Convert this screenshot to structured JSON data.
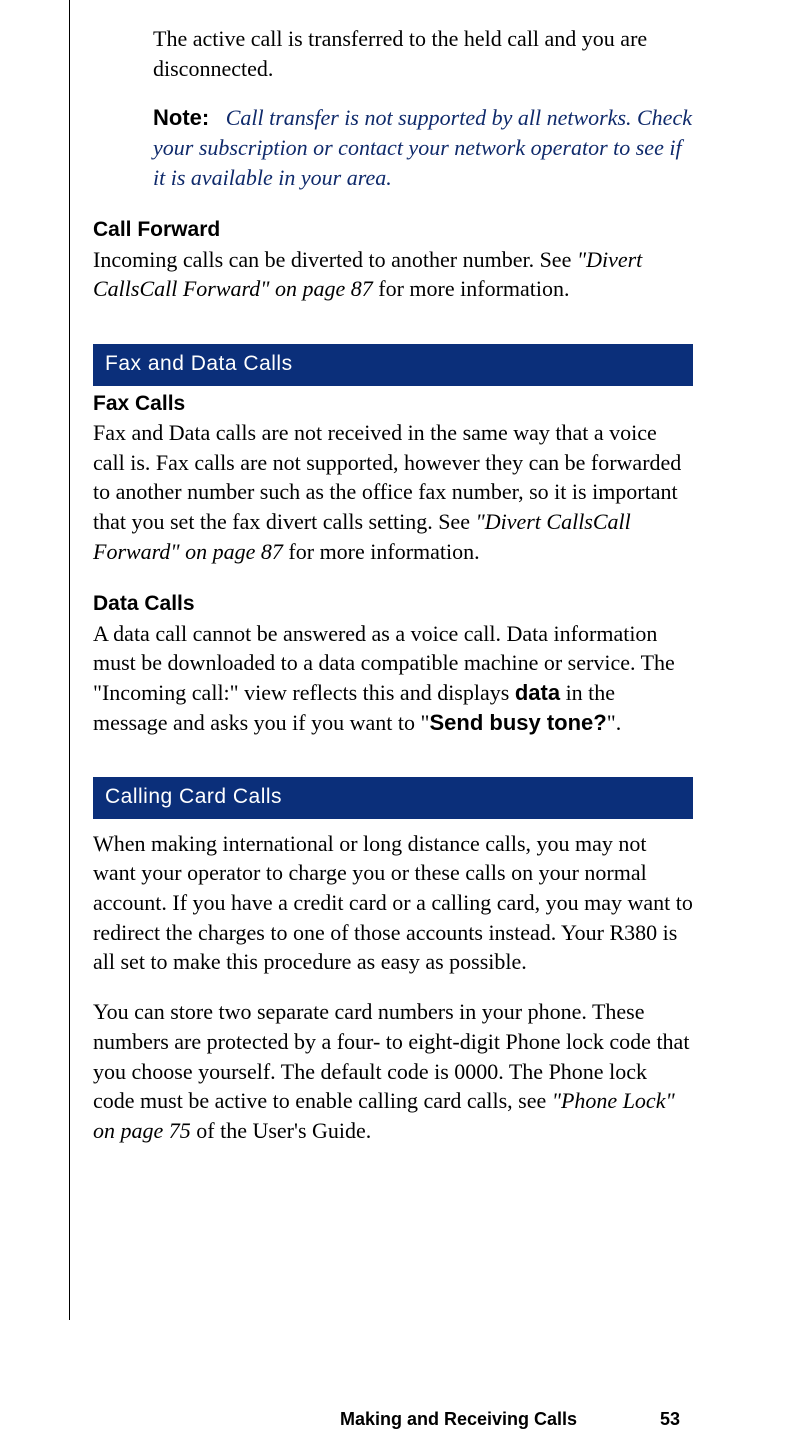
{
  "intro": {
    "transferred_text": "The active call is transferred to the held call and you are disconnected.",
    "note_label": "Note:",
    "note_text": "Call transfer is not supported by all networks. Check your subscription or contact your network operator to see if it is available in your area."
  },
  "call_forward": {
    "heading": "Call Forward",
    "text_a": "Incoming calls can be diverted to another number. See ",
    "ref": "\"Divert CallsCall Forward\" on page 87",
    "text_b": " for more information."
  },
  "fax_data": {
    "section_title": "Fax and Data Calls",
    "fax_heading": "Fax Calls",
    "fax_text_a": "Fax and Data calls are not received in the same way that a voice call is. Fax calls are not supported, however they can be forwarded to another number such as the office fax number, so it is important that you set the fax divert calls setting. See ",
    "fax_ref": "\"Divert CallsCall Forward\" on page 87",
    "fax_text_b": " for more information.",
    "data_heading": "Data Calls",
    "data_text_a": "A data call cannot be answered as a voice call. Data information must be downloaded to a data compatible machine or service. The \"Incoming call:\" view reflects this and displays ",
    "data_bold1": "data",
    "data_text_b": " in the message and asks you if you want to \"",
    "data_bold2": "Send busy tone?",
    "data_text_c": "\"."
  },
  "calling_card": {
    "section_title": "Calling Card Calls",
    "p1": "When making international or long distance calls, you may not want your operator to charge you or these calls on your normal account. If you have a credit card or a calling card, you may want to redirect the charges to one of those accounts instead. Your R380 is all set to make this procedure as easy as possible.",
    "p2_a": "You can store two separate card numbers in your phone. These numbers are protected by a four- to eight-digit Phone lock code that you choose yourself. The default code is 0000. The Phone lock code must be active to enable calling card calls, see ",
    "p2_ref": "\"Phone Lock\" on page 75",
    "p2_b": " of the User's Guide."
  },
  "footer": {
    "title": "Making and Receiving Calls",
    "page": "53"
  }
}
